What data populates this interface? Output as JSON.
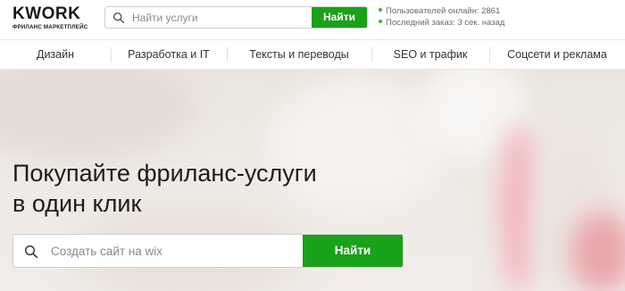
{
  "header": {
    "logo_text": "KWORK",
    "logo_subtitle": "ФРИЛАНС МАРКЕТПЛЕЙС",
    "search_placeholder": "Найти услуги",
    "search_button": "Найти",
    "stats": [
      "Пользователей онлайн: 2861",
      "Последний заказ: 3 сек. назад"
    ]
  },
  "nav": {
    "items": [
      "Дизайн",
      "Разработка и IT",
      "Тексты и переводы",
      "SEO и трафик",
      "Соцсети и реклама"
    ]
  },
  "hero": {
    "title_line1": "Покупайте фриланс-услуги",
    "title_line2": "в один клик",
    "search_placeholder": "Создать сайт на wix",
    "search_button": "Найти"
  },
  "colors": {
    "accent": "#1aa11a",
    "online_dot": "#35b435"
  },
  "icons": [
    "search-icon",
    "online-dot-icon"
  ]
}
